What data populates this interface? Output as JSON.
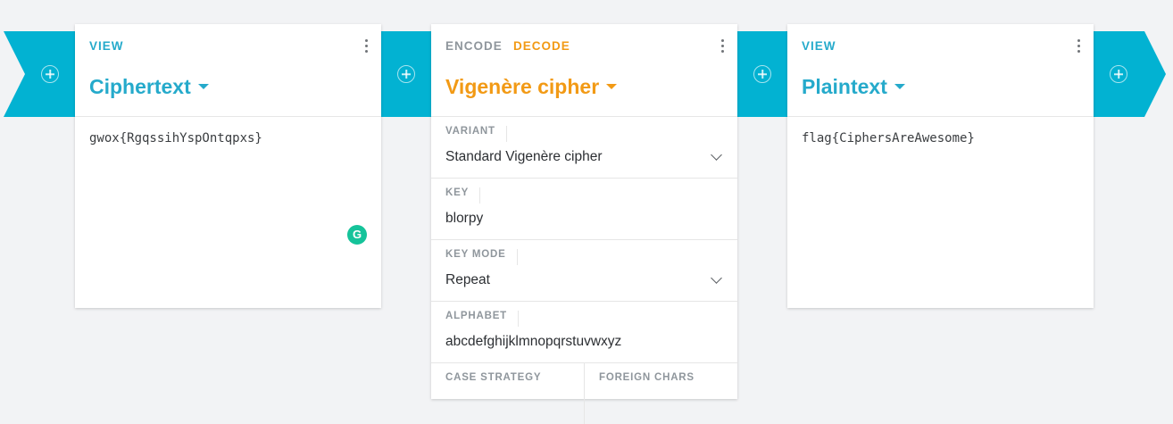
{
  "colors": {
    "accent": "#02b2d2",
    "view_blue": "#25aacb",
    "encode_orange": "#f29a15"
  },
  "icons": {
    "add": "plus-circle-icon",
    "menu": "kebab-menu-icon",
    "dropdown": "chevron-down-icon"
  },
  "card1": {
    "mode": "VIEW",
    "title": "Ciphertext",
    "content": "gwox{RgqssihYspOntqpxs}"
  },
  "card2": {
    "mode_encode": "ENCODE",
    "mode_decode": "DECODE",
    "title": "Vigenère cipher",
    "fields": {
      "variant": {
        "label": "VARIANT",
        "value": "Standard Vigenère cipher"
      },
      "key": {
        "label": "KEY",
        "value": "blorpy"
      },
      "key_mode": {
        "label": "KEY MODE",
        "value": "Repeat"
      },
      "alphabet": {
        "label": "ALPHABET",
        "value": "abcdefghijklmnopqrstuvwxyz"
      },
      "case_strategy": {
        "label": "CASE STRATEGY"
      },
      "foreign_chars": {
        "label": "FOREIGN CHARS"
      }
    }
  },
  "card3": {
    "mode": "VIEW",
    "title": "Plaintext",
    "content": "flag{CiphersAreAwesome}"
  }
}
